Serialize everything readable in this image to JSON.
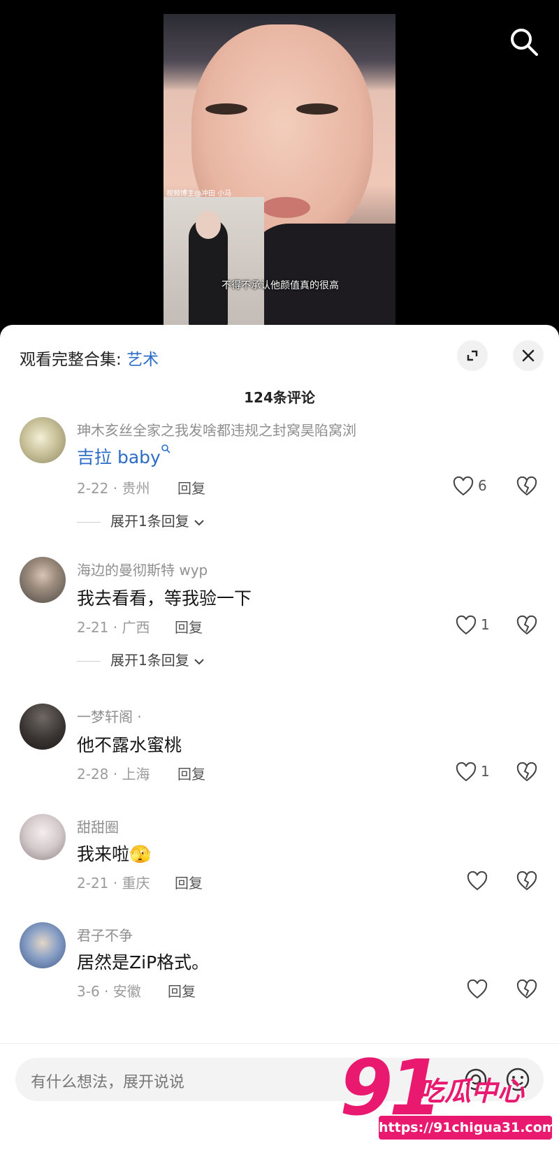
{
  "video": {
    "watermark_label": "视频博主@冲田 小马",
    "subtitle": "不得不承认他颜值真的很高"
  },
  "sheet": {
    "collection_prefix": "观看完整合集: ",
    "collection_link": "艺术",
    "comment_count": "124条评论"
  },
  "comments": [
    {
      "user": "珅木亥丝全家之我发啥都违规之封窝昊陷窝浏",
      "text": "吉拉 baby",
      "meta": "2-22 · 贵州",
      "reply": "回复",
      "likes": "6",
      "expand": "展开1条回复",
      "avatar_color": "#b8b48a"
    },
    {
      "user": "海边的曼彻斯特 wyp",
      "text": "我去看看，等我验一下",
      "meta": "2-21 · 广西",
      "reply": "回复",
      "likes": "1",
      "expand": "展开1条回复",
      "avatar_color": "#7a7672"
    },
    {
      "user": "一梦轩阁 ·",
      "text": "他不露水蜜桃",
      "meta": "2-28 · 上海",
      "reply": "回复",
      "likes": "1",
      "avatar_color": "#3d3a38"
    },
    {
      "user": "甜甜圈",
      "text": "我来啦🫣",
      "meta": "2-21 · 重庆",
      "reply": "回复",
      "likes": "",
      "avatar_color": "#d9d2d4"
    },
    {
      "user": "君子不争",
      "text": "居然是ZiP格式。",
      "meta": "3-6 · 安徽",
      "reply": "回复",
      "likes": "",
      "avatar_color": "#6d86b0"
    }
  ],
  "input": {
    "placeholder": "有什么想法，展开说说"
  },
  "site_watermark": {
    "number": "91",
    "name": "吃瓜中心",
    "url": "https://91chigua31.com"
  },
  "colors": {
    "link": "#2a6cc7",
    "brand_pink": "#e8196f"
  }
}
